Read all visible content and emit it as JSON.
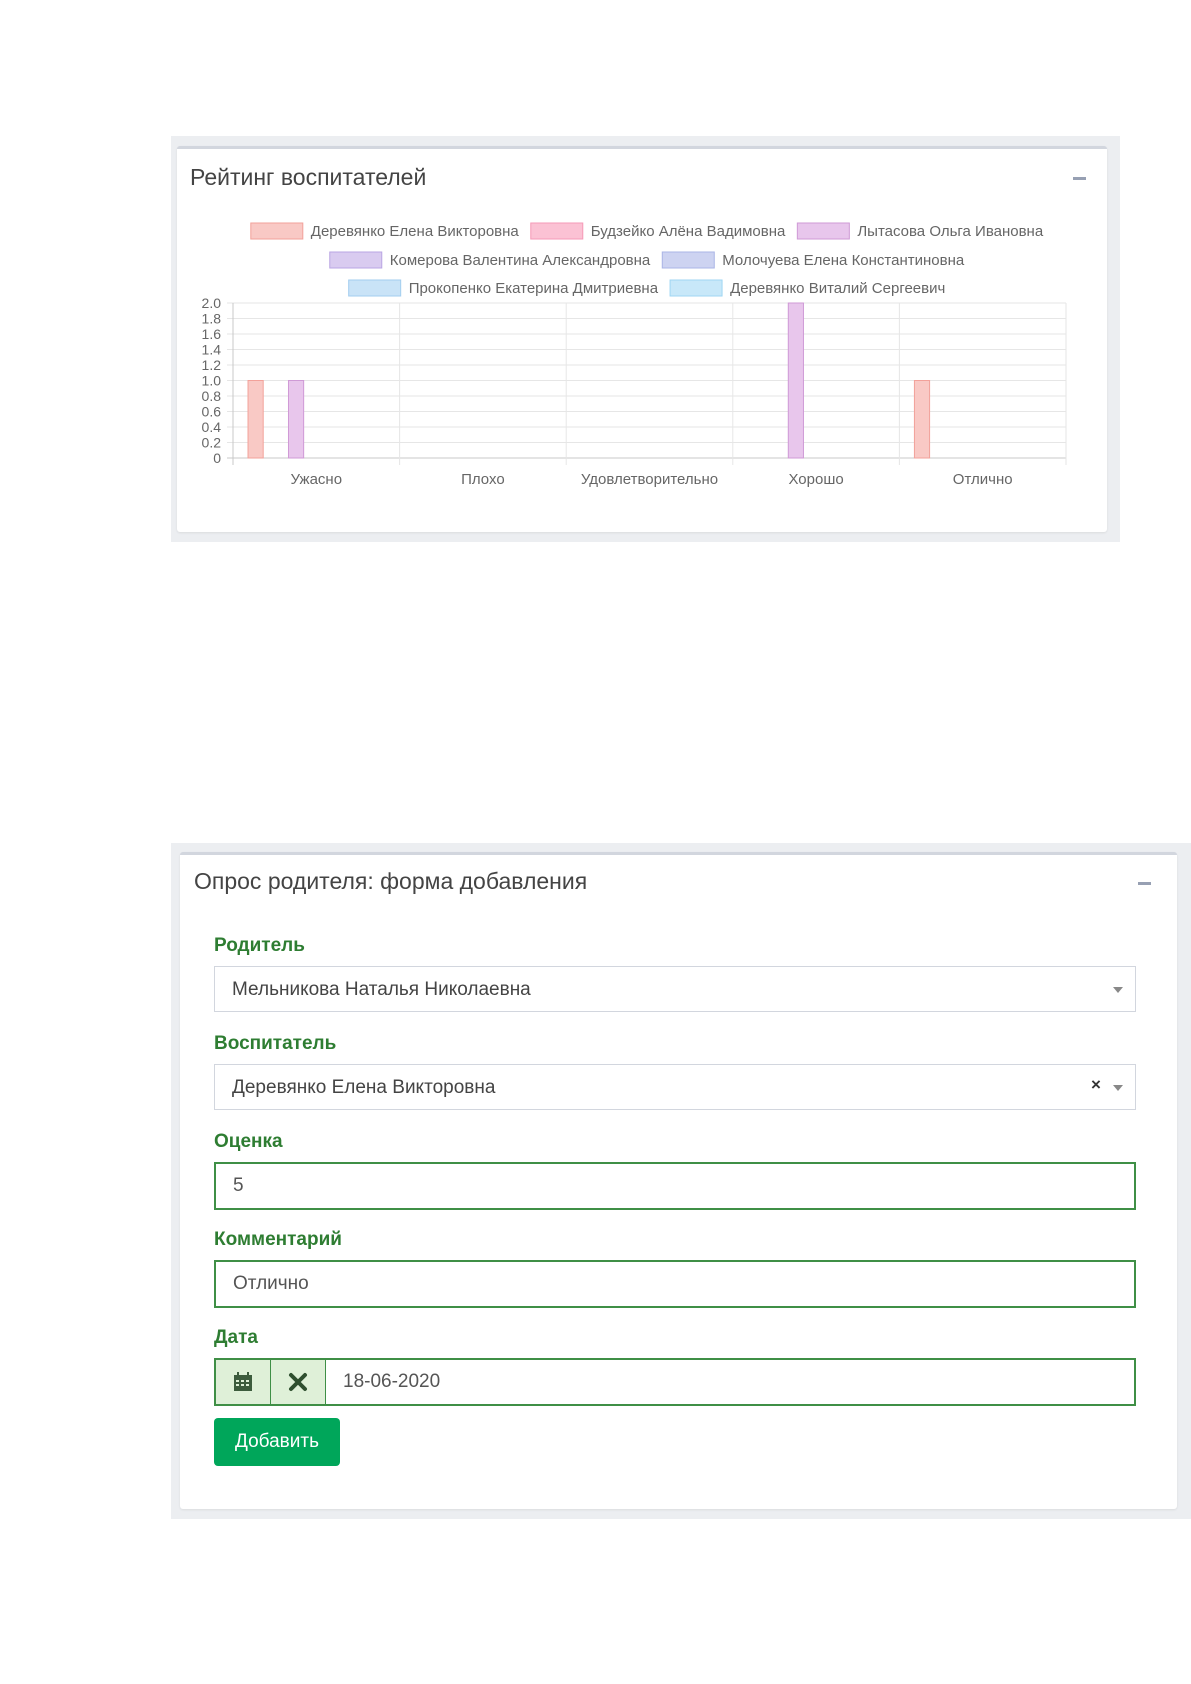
{
  "rating_panel": {
    "title": "Рейтинг воспитателей"
  },
  "chart_data": {
    "type": "bar",
    "categories": [
      "Ужасно",
      "Плохо",
      "Удовлетворительно",
      "Хорошо",
      "Отлично"
    ],
    "ylim": [
      0,
      2.0
    ],
    "yticks": [
      "2.0",
      "1.8",
      "1.6",
      "1.4",
      "1.2",
      "1.0",
      "0.8",
      "0.6",
      "0.4",
      "0.2",
      "0"
    ],
    "grid": true,
    "legend_position": "top",
    "series": [
      {
        "name": "Деревянко Елена Викторовна",
        "color": "#f9c9c5",
        "stroke": "#f2a19a",
        "values": [
          1,
          0,
          0,
          0,
          1
        ]
      },
      {
        "name": "Будзейко Алёна Вадимовна",
        "color": "#fbc2d4",
        "stroke": "#f59ab7",
        "values": [
          0,
          0,
          0,
          0,
          0
        ]
      },
      {
        "name": "Лытасова Ольга Ивановна",
        "color": "#e8c6ec",
        "stroke": "#cf9ad6",
        "values": [
          1,
          0,
          0,
          2,
          0
        ]
      },
      {
        "name": "Комерова Валентина Александровна",
        "color": "#d9cbf0",
        "stroke": "#b9a5e3",
        "values": [
          0,
          0,
          0,
          0,
          0
        ]
      },
      {
        "name": "Молочуева Елена Константиновна",
        "color": "#cdd3f1",
        "stroke": "#aab4e6",
        "values": [
          0,
          0,
          0,
          0,
          0
        ]
      },
      {
        "name": "Прокопенко Екатерина Дмитриевна",
        "color": "#c9e3f7",
        "stroke": "#a2cdef",
        "values": [
          0,
          0,
          0,
          0,
          0
        ]
      },
      {
        "name": "Деревянко Виталий Сергеевич",
        "color": "#c8e8f9",
        "stroke": "#9fd6f3",
        "values": [
          0,
          0,
          0,
          0,
          0
        ]
      }
    ]
  },
  "form_panel": {
    "title": "Опрос родителя: форма добавления",
    "parent_label": "Родитель",
    "parent_value": "Мельникова Наталья Николаевна",
    "teacher_label": "Воспитатель",
    "teacher_value": "Деревянко Елена Викторовна",
    "clear_symbol": "×",
    "score_label": "Оценка",
    "score_value": "5",
    "comment_label": "Комментарий",
    "comment_value": "Отлично",
    "date_label": "Дата",
    "date_value": "18-06-2020",
    "submit_label": "Добавить"
  },
  "icons": {
    "calendar": "calendar-icon",
    "clear": "times-icon",
    "collapse": "minus-icon"
  },
  "colors": {
    "label_green": "#2e7d32",
    "input_border_green": "#3f8f46",
    "button_green": "#00a65a",
    "addon_bg": "#dff0d8"
  }
}
